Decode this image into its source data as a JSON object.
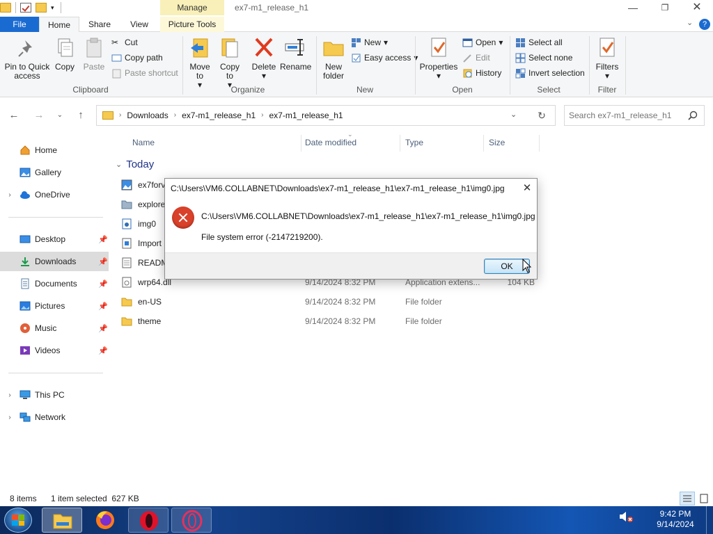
{
  "window": {
    "title": "ex7-m1_release_h1",
    "manage_label": "Manage",
    "min_glyph": "—",
    "max_glyph": "❐",
    "close_glyph": "✕"
  },
  "ribbon_tabs": {
    "file": "File",
    "home": "Home",
    "share": "Share",
    "view": "View",
    "picture_tools": "Picture Tools"
  },
  "ribbon": {
    "clipboard": {
      "label": "Clipboard",
      "pin_label": "Pin to Quick access",
      "copy_label": "Copy",
      "paste_label": "Paste",
      "cut_label": "Cut",
      "copy_path_label": "Copy path",
      "paste_shortcut_label": "Paste shortcut"
    },
    "organize": {
      "label": "Organize",
      "move_to_label": "Move to",
      "copy_to_label": "Copy to",
      "delete_label": "Delete",
      "rename_label": "Rename"
    },
    "new": {
      "label": "New",
      "new_folder_label": "New folder",
      "new_item_label": "New",
      "easy_access_label": "Easy access"
    },
    "open": {
      "label": "Open",
      "properties_label": "Properties",
      "open_label": "Open",
      "edit_label": "Edit",
      "history_label": "History"
    },
    "select": {
      "label": "Select",
      "select_all_label": "Select all",
      "select_none_label": "Select none",
      "invert_label": "Invert selection"
    },
    "filter": {
      "label": "Filter",
      "filters_label": "Filters"
    }
  },
  "address": {
    "crumbs": [
      "Downloads",
      "ex7-m1_release_h1",
      "ex7-m1_release_h1"
    ],
    "search_placeholder": "Search ex7-m1_release_h1"
  },
  "nav": {
    "items": [
      {
        "label": "Home",
        "icon": "home-icon"
      },
      {
        "label": "Gallery",
        "icon": "gallery-icon"
      },
      {
        "label": "OneDrive",
        "icon": "cloud-icon"
      },
      {
        "label": "Desktop",
        "icon": "desktop-icon"
      },
      {
        "label": "Downloads",
        "icon": "download-icon"
      },
      {
        "label": "Documents",
        "icon": "documents-icon"
      },
      {
        "label": "Pictures",
        "icon": "pictures-icon"
      },
      {
        "label": "Music",
        "icon": "music-icon"
      },
      {
        "label": "Videos",
        "icon": "videos-icon"
      },
      {
        "label": "This PC",
        "icon": "computer-icon"
      },
      {
        "label": "Network",
        "icon": "network-icon"
      }
    ]
  },
  "filelist": {
    "headers": {
      "name": "Name",
      "date": "Date modified",
      "type": "Type",
      "size": "Size"
    },
    "group": "Today",
    "rows": [
      {
        "name": "ex7forv",
        "date": "",
        "type": "",
        "size": ""
      },
      {
        "name": "explore",
        "date": "",
        "type": "",
        "size": ""
      },
      {
        "name": "img0",
        "date": "",
        "type": "",
        "size": ""
      },
      {
        "name": "Import",
        "date": "",
        "type": "",
        "size": ""
      },
      {
        "name": "READM",
        "date": "",
        "type": "",
        "size": ""
      },
      {
        "name": "wrp64.dll",
        "date": "9/14/2024 8:32 PM",
        "type": "Application extens...",
        "size": "104 KB"
      },
      {
        "name": "en-US",
        "date": "9/14/2024 8:32 PM",
        "type": "File folder",
        "size": ""
      },
      {
        "name": "theme",
        "date": "9/14/2024 8:32 PM",
        "type": "File folder",
        "size": ""
      }
    ]
  },
  "status": {
    "item_count": "8 items",
    "selection": "1 item selected  627 KB"
  },
  "dialog": {
    "title": "C:\\Users\\VM6.COLLABNET\\Downloads\\ex7-m1_release_h1\\ex7-m1_release_h1\\img0.jpg",
    "path": "C:\\Users\\VM6.COLLABNET\\Downloads\\ex7-m1_release_h1\\ex7-m1_release_h1\\img0.jpg",
    "message": "File system error (-2147219200).",
    "ok_label": "OK",
    "close_glyph": "✕"
  },
  "taskbar": {
    "time": "9:42 PM",
    "date": "9/14/2024"
  },
  "colors": {
    "accent": "#1a6bd1",
    "error": "#d9412a",
    "manage_tab": "#f8f0b8"
  }
}
